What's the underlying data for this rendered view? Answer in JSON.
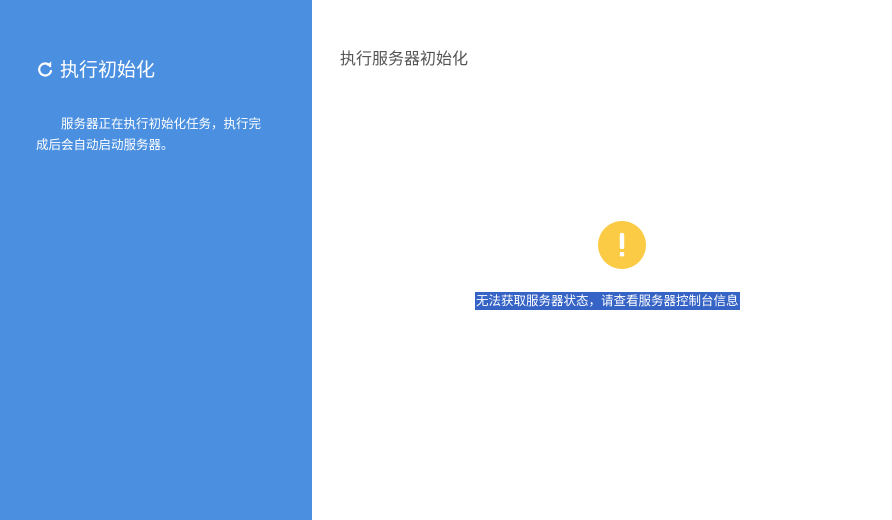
{
  "sidebar": {
    "title": "执行初始化",
    "icon": "refresh-icon",
    "description": "服务器正在执行初始化任务，执行完成后会自动启动服务器。",
    "background_color": "#4a8fe0"
  },
  "main": {
    "title": "执行服务器初始化",
    "status_icon": "warning-icon",
    "status_icon_color": "#fccb45",
    "message": "无法获取服务器状态，请查看服务器控制台信息"
  }
}
